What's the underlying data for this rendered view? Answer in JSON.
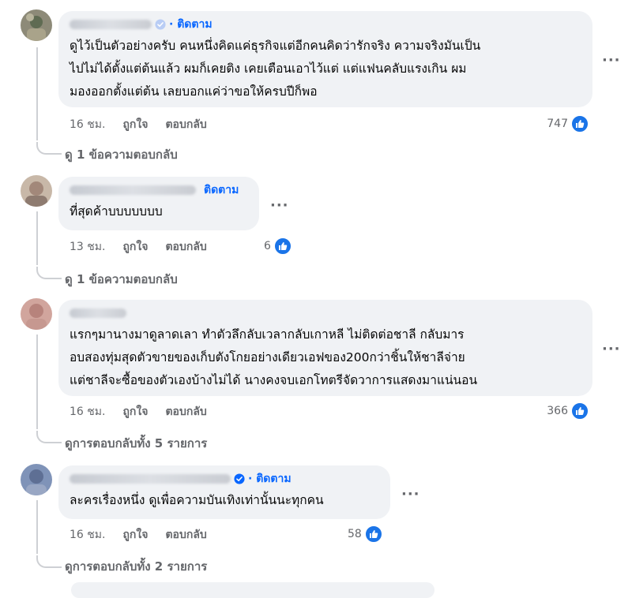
{
  "comments": [
    {
      "follow_label": "· ติดตาม",
      "text": "ดูไว้เป็นตัวอย่างครับ คนหนึ่งคิดแค่ธุรกิจแต่อีกคนคิดว่ารักจริง ความจริงมันเป็น\nไปไม่ได้ตั้งแต่ต้นแล้ว ผมก็เคยติง เคยเตือนเอาไว้แต่ แต่แฟนคลับแรงเกิน ผม\nมองออกตั้งแต่ต้น เลยบอกแค่ว่าขอให้ครบปีก็พอ",
      "time": "16 ชม.",
      "like_label": "ถูกใจ",
      "reply_label": "ตอบกลับ",
      "reaction_count": "747",
      "view_replies": "ดู 1 ข้อความตอบกลับ",
      "verified": true
    },
    {
      "follow_label": "ติดตาม",
      "text": "ที่สุดค้าบบบบบบบ",
      "time": "13 ชม.",
      "like_label": "ถูกใจ",
      "reply_label": "ตอบกลับ",
      "reaction_count": "6",
      "view_replies": "ดู 1 ข้อความตอบกลับ",
      "verified": false
    },
    {
      "follow_label": "",
      "text": "แรกๆมานางมาดูลาดเลา ทำตัวลึกลับเวลากลับเกาหลี ไม่ติดต่อชาลี กลับมาร\nอบสองทุ่มสุดตัวขายของเก็บตังโกยอย่างเดียวเอฟของ200กว่าชิ้นให้ชาลีจ่าย\nแต่ชาลีจะซื้อของตัวเองบ้างไม่ได้ นางคงจบเอกโทตรีจัดวาการแสดงมาแน่นอน",
      "time": "16 ชม.",
      "like_label": "ถูกใจ",
      "reply_label": "ตอบกลับ",
      "reaction_count": "366",
      "view_replies": "ดูการตอบกลับทั้ง 5 รายการ",
      "verified": false
    },
    {
      "follow_label": "· ติดตาม",
      "text": "ละครเรื่องหนึ่ง ดูเพื่อความบันเทิงเท่านั้นนะทุกคน",
      "time": "16 ชม.",
      "like_label": "ถูกใจ",
      "reply_label": "ตอบกลับ",
      "reaction_count": "58",
      "view_replies": "ดูการตอบกลับทั้ง 2 รายการ",
      "verified": true
    }
  ],
  "more_options_glyph": "···",
  "icons": {
    "reaction": "like-thumb-icon",
    "verified": "verified-badge-icon",
    "more": "more-options-icon"
  },
  "colors": {
    "accent": "#0866ff",
    "like_blue": "#1a74e8",
    "bubble": "#f0f2f5",
    "meta_text": "#65676b"
  }
}
